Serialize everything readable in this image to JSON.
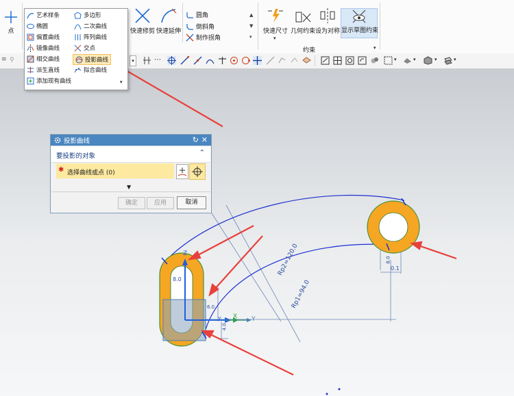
{
  "ribbon": {
    "point_label": "点",
    "quick_trim": "快速修剪",
    "quick_extend": "快速延伸",
    "fillet": "圆角",
    "chamfer": "倒斜角",
    "make_corner": "制作拐角",
    "quick_dimension": "快速尺寸",
    "geometric_constraints": "几何约束",
    "make_symmetric": "设为对称",
    "display_sketch_constraints": "显示草图约束",
    "group_constraints": "约束"
  },
  "curve_menu": {
    "items": [
      {
        "label": "艺术样条",
        "icon": "spline-icon"
      },
      {
        "label": "多边形",
        "icon": "polygon-icon"
      },
      {
        "label": "椭圆",
        "icon": "ellipse-icon"
      },
      {
        "label": "二次曲线",
        "icon": "conic-icon"
      },
      {
        "label": "偏置曲线",
        "icon": "offset-curve-icon"
      },
      {
        "label": "阵列曲线",
        "icon": "pattern-curve-icon"
      },
      {
        "label": "镜像曲线",
        "icon": "mirror-curve-icon"
      },
      {
        "label": "交点",
        "icon": "intersection-point-icon"
      },
      {
        "label": "相交曲线",
        "icon": "intersection-curve-icon"
      },
      {
        "label": "投影曲线",
        "icon": "project-curve-icon"
      },
      {
        "label": "派生直线",
        "icon": "derived-line-icon"
      },
      {
        "label": "拟合曲线",
        "icon": "fit-curve-icon"
      },
      {
        "label": "添加现有曲线",
        "icon": "add-existing-curve-icon"
      }
    ]
  },
  "dialog": {
    "title": "投影曲线",
    "section_title": "要投影的对象",
    "select_label": "选择曲线或点 (0)",
    "ok": "确定",
    "apply": "应用",
    "cancel": "取消"
  },
  "viewport": {
    "dim_120": "Rp2=120.0",
    "dim_94": "Rp1=94.0",
    "dim_80": "8.0",
    "dim_60": "6.0",
    "dim_small": "8.0",
    "dim_01": "0.1",
    "dim_40": "4.0",
    "axis_x": "X",
    "axis_y": "Y",
    "axis_z": "Z",
    "axis_x2": "Y"
  },
  "colors": {
    "accent_orange": "#f5a623",
    "sketch_blue": "#1a2fd0",
    "arrow_red": "#e8403a",
    "dialog_title": "#4a86c0",
    "highlight_yellow": "#fde9a0"
  }
}
